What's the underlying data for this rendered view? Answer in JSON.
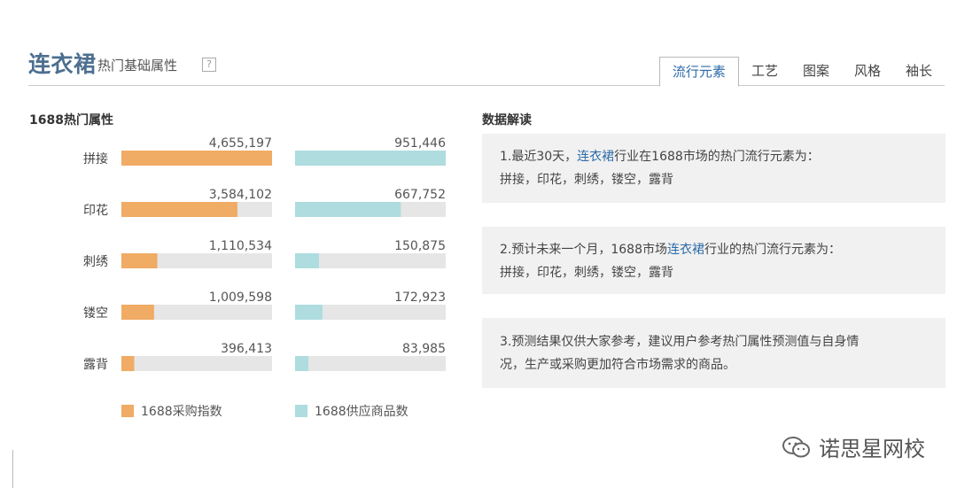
{
  "header": {
    "title_main": "连衣裙",
    "title_sub": "热门基础属性",
    "help": "?"
  },
  "tabs": [
    {
      "label": "流行元素",
      "active": true
    },
    {
      "label": "工艺",
      "active": false
    },
    {
      "label": "图案",
      "active": false
    },
    {
      "label": "风格",
      "active": false
    },
    {
      "label": "袖长",
      "active": false
    }
  ],
  "left_section_title": "1688热门属性",
  "right_section_title": "数据解读",
  "chart_data": {
    "type": "bar",
    "categories": [
      "拼接",
      "印花",
      "刺绣",
      "镂空",
      "露背"
    ],
    "series": [
      {
        "name": "1688采购指数",
        "values": [
          4655197,
          3584102,
          1110534,
          1009598,
          396413
        ],
        "value_labels": [
          "4,655,197",
          "3,584,102",
          "1,110,534",
          "1,009,598",
          "396,413"
        ],
        "color": "#f0ab64"
      },
      {
        "name": "1688供应商品数",
        "values": [
          951446,
          667752,
          150875,
          172923,
          83985
        ],
        "value_labels": [
          "951,446",
          "667,752",
          "150,875",
          "172,923",
          "83,985"
        ],
        "color": "#aedcdf"
      }
    ],
    "track_color": "#e6e6e6",
    "legend_position": "bottom"
  },
  "insights": [
    {
      "prefix": "1.最近30天，",
      "highlight": "连衣裙",
      "suffix": "行业在1688市场的热门流行元素为：",
      "line2": "拼接，印花，刺绣，镂空，露背"
    },
    {
      "prefix": "2.预计未来一个月，1688市场",
      "highlight": "连衣裙",
      "suffix": "行业的热门流行元素为：",
      "line2": "拼接，印花，刺绣，镂空，露背"
    },
    {
      "prefix": "3.预测结果仅供大家参考，建议用户参考热门属性预测值与自身情",
      "highlight": "",
      "suffix": "",
      "line2": "况，生产或采购更加符合市场需求的商品。"
    }
  ],
  "watermark": "诺思星网校"
}
